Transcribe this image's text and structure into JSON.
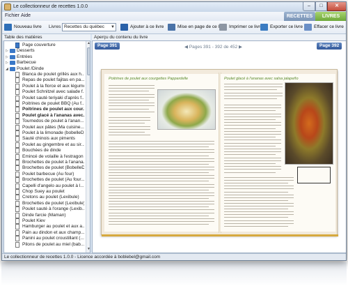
{
  "window": {
    "title": "Le collectionneur de recettes 1.0.0"
  },
  "title_buttons": {
    "minimize": "–",
    "maximize": "□",
    "close": "✕"
  },
  "menu": {
    "items": [
      "Fichier",
      "Aide"
    ]
  },
  "mode_tabs": {
    "recettes": "RECETTES",
    "livres": "LIVRES"
  },
  "toolbar": {
    "new_book": "Nouveau livre",
    "books_label": "Livres :",
    "books_selected": "Recettes du québec",
    "add_to_book": "Ajouter à ce livre",
    "layout_book": "Mise en page de ce livre",
    "print_book": "Imprimer ce livre",
    "export_book": "Exporter ce livre",
    "delete_book": "Effacer ce livre"
  },
  "left_panel": {
    "header": "Table des matières",
    "items": [
      {
        "label": "Page couverture",
        "type": "page",
        "level": 1,
        "bold": false
      },
      {
        "label": "Desserts",
        "type": "folder",
        "level": 0,
        "bold": false
      },
      {
        "label": "Entrées",
        "type": "folder",
        "level": 0,
        "bold": false
      },
      {
        "label": "Barbecue",
        "type": "folder",
        "level": 0,
        "bold": false
      },
      {
        "label": "Poulet /Dinde",
        "type": "folder-open",
        "level": 0,
        "bold": false
      },
      {
        "label": "Blanca de poulet grillés aux h...",
        "type": "doc",
        "level": 1,
        "bold": false
      },
      {
        "label": "Repas de poulet fajitas en pa...",
        "type": "doc",
        "level": 1,
        "bold": false
      },
      {
        "label": "Poulet à la florce et aux légumes",
        "type": "doc",
        "level": 1,
        "bold": false
      },
      {
        "label": "Poulet Schnitzel avec salade f...",
        "type": "doc",
        "level": 1,
        "bold": false
      },
      {
        "label": "Poulet sauté teriyaki d'après f...",
        "type": "doc",
        "level": 1,
        "bold": false
      },
      {
        "label": "Poitrines de poulet BBQ (Au f...",
        "type": "doc",
        "level": 1,
        "bold": false
      },
      {
        "label": "Poitrines de poulet aux cour...",
        "type": "doc",
        "level": 1,
        "bold": true
      },
      {
        "label": "Poulet glacé à l'ananas avec...",
        "type": "doc",
        "level": 1,
        "bold": true
      },
      {
        "label": "Tournedos de poulet à l'anan...",
        "type": "doc",
        "level": 1,
        "bold": false
      },
      {
        "label": "Poulet aux pâtes (Ma cuisine...",
        "type": "doc",
        "level": 1,
        "bold": false
      },
      {
        "label": "Poulet à la limonade (bobelleD)",
        "type": "doc",
        "level": 1,
        "bold": false
      },
      {
        "label": "Sauté chinois aux piments",
        "type": "doc",
        "level": 1,
        "bold": false
      },
      {
        "label": "Poulet au gingembre et au sir...",
        "type": "doc",
        "level": 1,
        "bold": false
      },
      {
        "label": "Bouchées de dinde",
        "type": "doc",
        "level": 1,
        "bold": false
      },
      {
        "label": "Emincé de volaille à l'estragon",
        "type": "doc",
        "level": 1,
        "bold": false
      },
      {
        "label": "Brochettes de poulet à l'anana...",
        "type": "doc",
        "level": 1,
        "bold": false
      },
      {
        "label": "Brochettes de poulet (BobelleD)",
        "type": "doc",
        "level": 1,
        "bold": false
      },
      {
        "label": "Poulet barbecue (Au four)",
        "type": "doc",
        "level": 1,
        "bold": false
      },
      {
        "label": "Brochettes de poulet (Au four...",
        "type": "doc",
        "level": 1,
        "bold": false
      },
      {
        "label": "Capelli d'angelo au poulet à l...",
        "type": "doc",
        "level": 1,
        "bold": false
      },
      {
        "label": "Chop Suey au poulet",
        "type": "doc",
        "level": 1,
        "bold": false
      },
      {
        "label": "Cretons au poulet (Lexibule)",
        "type": "doc",
        "level": 1,
        "bold": false
      },
      {
        "label": "Brochettes de poulet (Lexibule)",
        "type": "doc",
        "level": 1,
        "bold": false
      },
      {
        "label": "Poulet sauté à l'orange (Lexib...",
        "type": "doc",
        "level": 1,
        "bold": false
      },
      {
        "label": "Dinde farcie (Maman)",
        "type": "doc",
        "level": 1,
        "bold": false
      },
      {
        "label": "Poulet Kiev",
        "type": "doc",
        "level": 1,
        "bold": false
      },
      {
        "label": "Hamburger au poulet et aux a...",
        "type": "doc",
        "level": 1,
        "bold": false
      },
      {
        "label": "Pain au dindon et aux champ...",
        "type": "doc",
        "level": 1,
        "bold": false
      },
      {
        "label": "Panini au poulet croustillant (...",
        "type": "doc",
        "level": 1,
        "bold": false
      },
      {
        "label": "Pilons de poulet au miel (bab...",
        "type": "doc",
        "level": 1,
        "bold": false
      }
    ]
  },
  "right_panel": {
    "header": "Aperçu du contenu du livre",
    "prev_page": "Page 391",
    "next_page": "Page 392",
    "pages_info": "Pages 391 - 392 de 452",
    "left_recipe_title": "Poitrines de poulet aux courgettes Pappardelle",
    "right_recipe_title": "Poulet glacé à l'ananas avec salsa jalapeño"
  },
  "status": {
    "text": "Le collectionneur de recettes 1.0.0 - Licence accordée à boblebel@gmail.com"
  },
  "colors": {
    "tab_recettes": "#7a94b6",
    "tab_livres": "#6ea83a",
    "page_button": "#33599a",
    "book_edge": "#d6a93e"
  }
}
